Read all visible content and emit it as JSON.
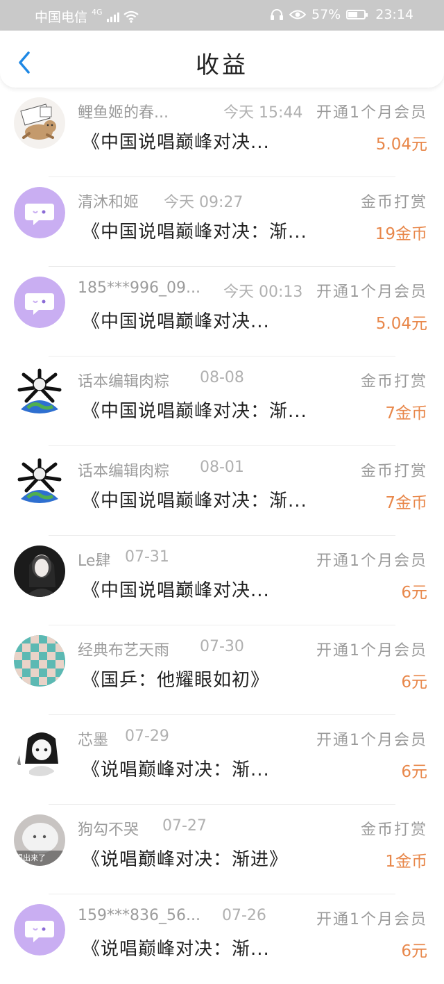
{
  "status_bar": {
    "carrier": "中国电信",
    "network": "4G",
    "battery": "57%",
    "battery_level": 0.57,
    "time": "23:14"
  },
  "header": {
    "back_icon": "chevron-left-icon",
    "title": "收益"
  },
  "records": [
    {
      "name": "鲤鱼姬的春...",
      "date": "今天 15:44",
      "type": "开通1个月会员",
      "work": "《中国说唱巅峰对决...",
      "amount": "5.04元"
    },
    {
      "name": "清沐和姬",
      "date": "今天 09:27",
      "type": "金币打赏",
      "work": "《中国说唱巅峰对决：渐...",
      "amount": "19金币"
    },
    {
      "name": "185***996_09...",
      "date": "今天 00:13",
      "type": "开通1个月会员",
      "work": "《中国说唱巅峰对决...",
      "amount": "5.04元"
    },
    {
      "name": "话本编辑肉粽",
      "date": "08-08",
      "type": "金币打赏",
      "work": "《中国说唱巅峰对决：渐...",
      "amount": "7金币"
    },
    {
      "name": "话本编辑肉粽",
      "date": "08-01",
      "type": "金币打赏",
      "work": "《中国说唱巅峰对决：渐...",
      "amount": "7金币"
    },
    {
      "name": "Le肆",
      "date": "07-31",
      "type": "开通1个月会员",
      "work": "《中国说唱巅峰对决...",
      "amount": "6元"
    },
    {
      "name": "经典布艺天雨",
      "date": "07-30",
      "type": "开通1个月会员",
      "work": "《国乒：他耀眼如初》",
      "amount": "6元"
    },
    {
      "name": "芯墨",
      "date": "07-29",
      "type": "开通1个月会员",
      "work": "《说唱巅峰对决：渐...",
      "amount": "6元"
    },
    {
      "name": "狗勾不哭",
      "date": "07-27",
      "type": "金币打赏",
      "work": "《说唱巅峰对决：渐进》",
      "amount": "1金币"
    },
    {
      "name": "159***836_56...",
      "date": "07-26",
      "type": "开通1个月会员",
      "work": "《说唱巅峰对决：渐...",
      "amount": "6元"
    }
  ],
  "avatar_photo_text": "跟出来了",
  "colors": {
    "accent": "#1e88e5",
    "amount": "#e8874a",
    "default_avatar": "#c9aef2",
    "status_bar": "#c9c9c9"
  }
}
